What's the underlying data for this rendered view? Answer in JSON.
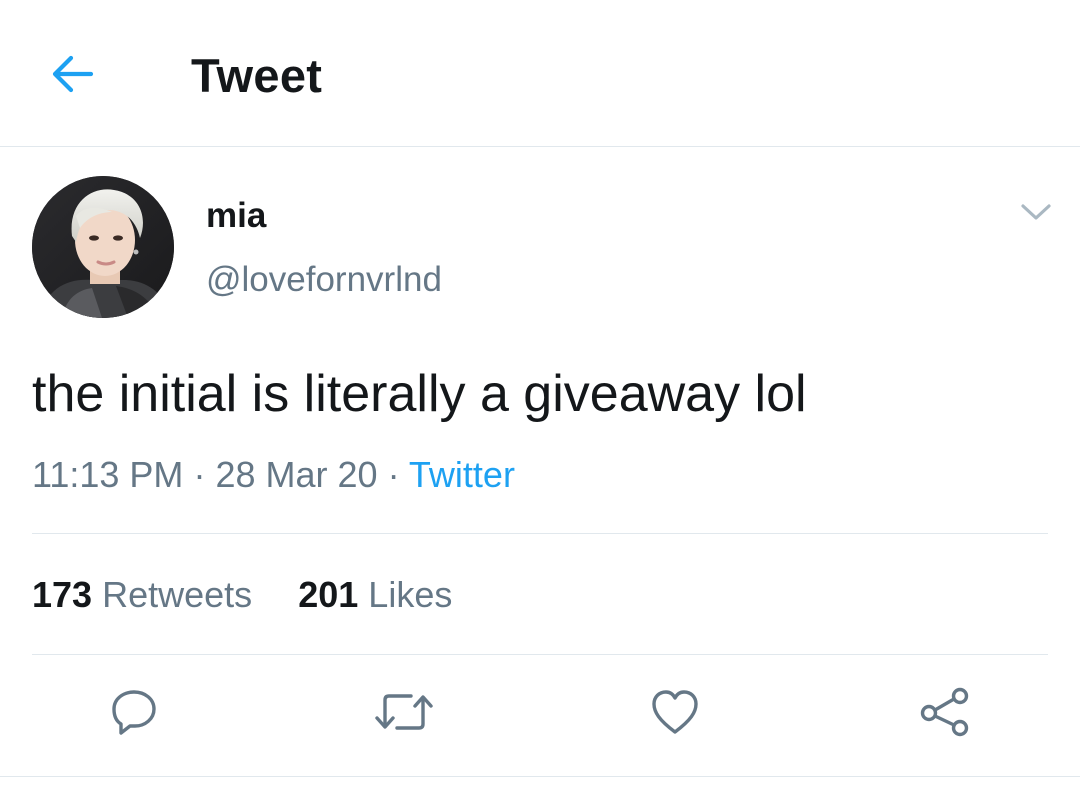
{
  "header": {
    "title": "Tweet",
    "back_icon": "arrow-left-icon"
  },
  "colors": {
    "accent": "#1da1f2",
    "secondary_text": "#657786",
    "divider": "#e1e8ed"
  },
  "tweet": {
    "author": {
      "display_name": "mia",
      "handle": "@lovefornvrlnd"
    },
    "text": "the initial is literally a giveaway lol",
    "time": "11:13 PM",
    "date": "28 Mar 20",
    "separator": "·",
    "source": "Twitter"
  },
  "stats": {
    "retweets_count": "173",
    "retweets_label": "Retweets",
    "likes_count": "201",
    "likes_label": "Likes"
  },
  "actions": [
    {
      "icon": "reply-icon"
    },
    {
      "icon": "retweet-icon"
    },
    {
      "icon": "heart-icon"
    },
    {
      "icon": "share-icon"
    }
  ]
}
